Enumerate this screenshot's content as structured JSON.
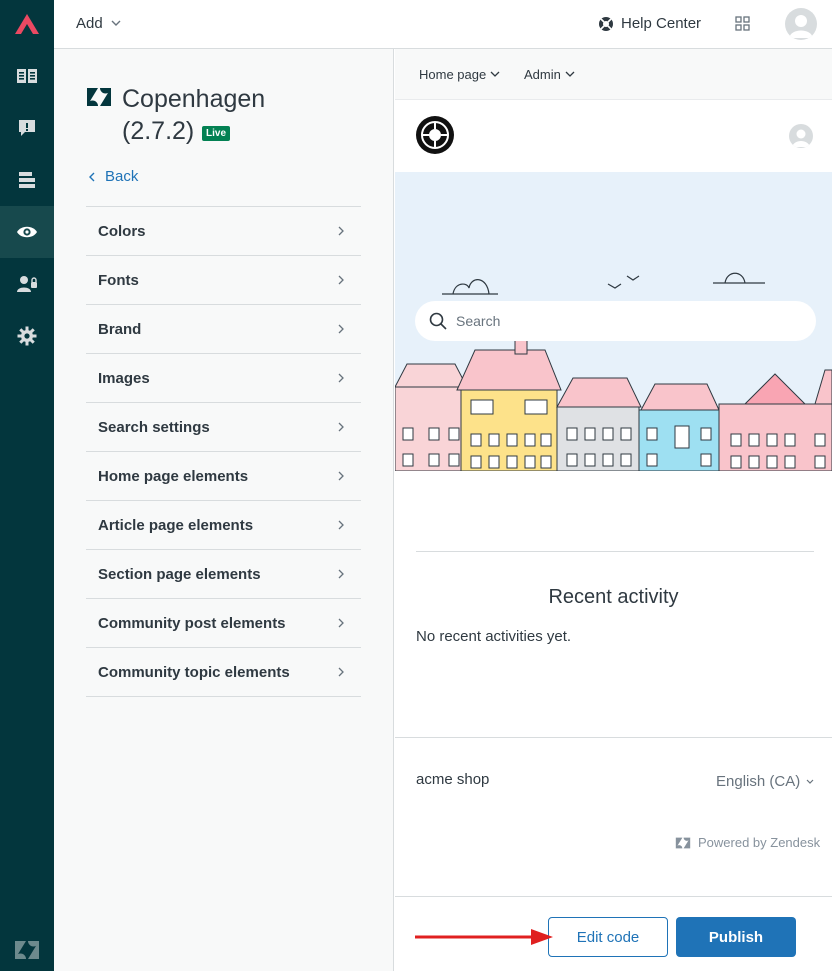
{
  "topbar": {
    "add_label": "Add",
    "help_center_label": "Help Center"
  },
  "theme": {
    "name": "Copenhagen",
    "version": "(2.7.2)",
    "live_badge": "Live"
  },
  "panel": {
    "back_label": "Back",
    "settings": [
      "Colors",
      "Fonts",
      "Brand",
      "Images",
      "Search settings",
      "Home page elements",
      "Article page elements",
      "Section page elements",
      "Community post elements",
      "Community topic elements"
    ]
  },
  "preview": {
    "menu_home": "Home page",
    "menu_admin": "Admin",
    "search_placeholder": "Search",
    "recent_title": "Recent activity",
    "recent_empty": "No recent activities yet.",
    "footer_brand": "acme shop",
    "footer_language": "English (CA)",
    "powered_by": "Powered by Zendesk",
    "edit_code_label": "Edit code",
    "publish_label": "Publish"
  },
  "colors": {
    "rail": "#03363d",
    "primary": "#1f73b7",
    "live": "#038153",
    "arrow": "#e02020"
  }
}
